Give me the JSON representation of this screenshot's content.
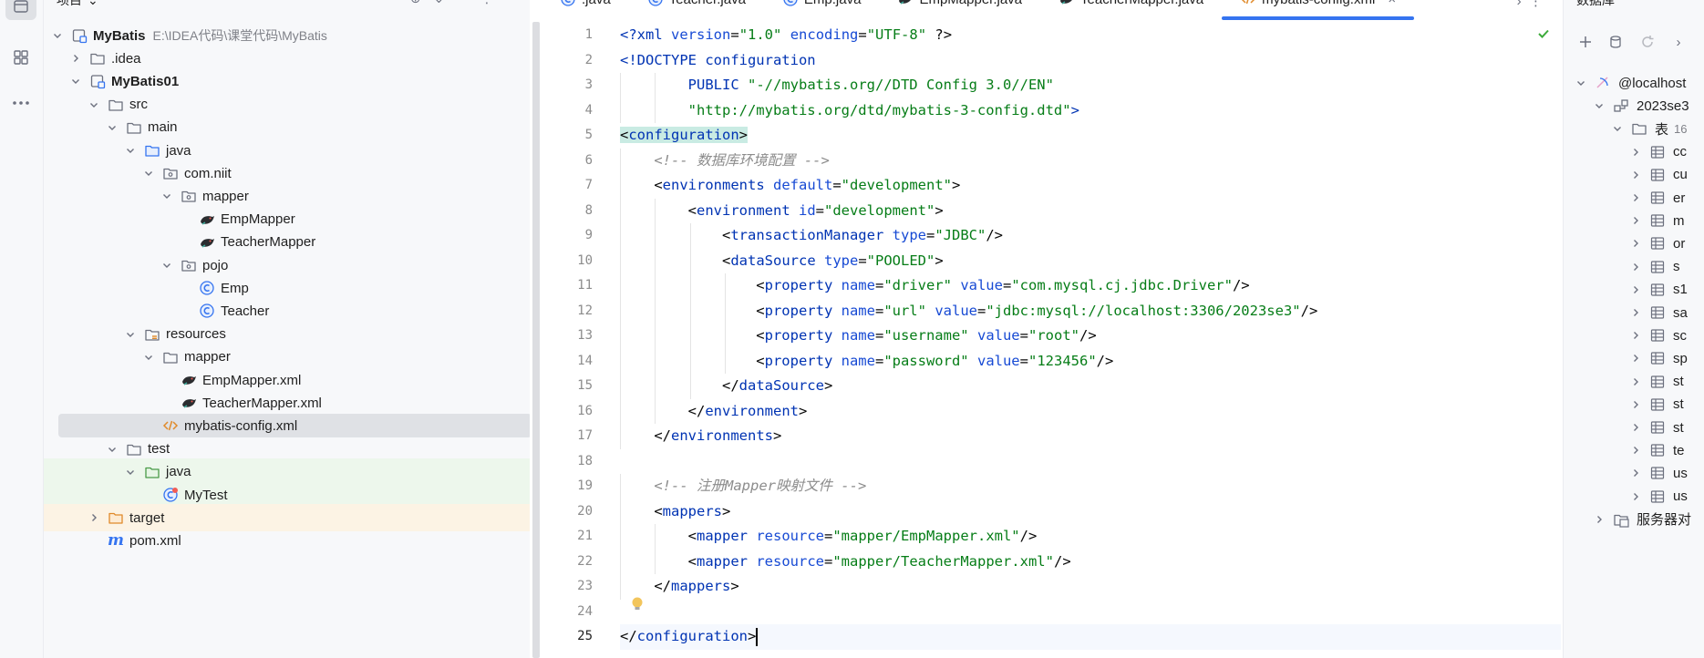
{
  "activity_bar": {
    "icons": [
      "project-icon",
      "structure-icon",
      "more-icon"
    ]
  },
  "project_panel": {
    "title": "项目",
    "tree": [
      {
        "label": "MyBatis",
        "path": "E:\\IDEA代码\\课堂代码\\MyBatis",
        "icon": "module-icon",
        "depth": 0,
        "expanded": true,
        "bold": true
      },
      {
        "label": ".idea",
        "icon": "folder-icon",
        "depth": 1,
        "expanded": false
      },
      {
        "label": "MyBatis01",
        "icon": "module-icon",
        "depth": 1,
        "expanded": true,
        "bold": true
      },
      {
        "label": "src",
        "icon": "folder-icon",
        "depth": 2,
        "expanded": true
      },
      {
        "label": "main",
        "icon": "folder-icon",
        "depth": 3,
        "expanded": true
      },
      {
        "label": "java",
        "icon": "source-folder-icon",
        "depth": 4,
        "expanded": true
      },
      {
        "label": "com.niit",
        "icon": "package-icon",
        "depth": 5,
        "expanded": true
      },
      {
        "label": "mapper",
        "icon": "package-icon",
        "depth": 6,
        "expanded": true
      },
      {
        "label": "EmpMapper",
        "icon": "mybatis-bird-icon",
        "depth": 7,
        "leaf": true
      },
      {
        "label": "TeacherMapper",
        "icon": "mybatis-bird-icon",
        "depth": 7,
        "leaf": true
      },
      {
        "label": "pojo",
        "icon": "package-icon",
        "depth": 6,
        "expanded": true
      },
      {
        "label": "Emp",
        "icon": "class-icon",
        "depth": 7,
        "leaf": true
      },
      {
        "label": "Teacher",
        "icon": "class-icon",
        "depth": 7,
        "leaf": true
      },
      {
        "label": "resources",
        "icon": "resources-folder-icon",
        "depth": 4,
        "expanded": true
      },
      {
        "label": "mapper",
        "icon": "folder-icon",
        "depth": 5,
        "expanded": true
      },
      {
        "label": "EmpMapper.xml",
        "icon": "mybatis-bird-icon",
        "depth": 6,
        "leaf": true
      },
      {
        "label": "TeacherMapper.xml",
        "icon": "mybatis-bird-icon",
        "depth": 6,
        "leaf": true
      },
      {
        "label": "mybatis-config.xml",
        "icon": "xml-icon",
        "depth": 5,
        "leaf": true,
        "selected": true
      },
      {
        "label": "test",
        "icon": "folder-icon",
        "depth": 3,
        "expanded": true
      },
      {
        "label": "java",
        "icon": "test-folder-icon",
        "depth": 4,
        "expanded": true,
        "highlight": "green"
      },
      {
        "label": "MyTest",
        "icon": "test-class-icon",
        "depth": 5,
        "leaf": true,
        "highlight": "green"
      },
      {
        "label": "target",
        "icon": "excluded-folder-icon",
        "depth": 2,
        "expanded": false,
        "highlight": "orange"
      },
      {
        "label": "pom.xml",
        "icon": "maven-icon",
        "depth": 2,
        "leaf": true
      }
    ]
  },
  "editor": {
    "tabs": [
      {
        "label": ".java",
        "icon": "class-icon"
      },
      {
        "label": "Teacher.java",
        "icon": "class-icon"
      },
      {
        "label": "Emp.java",
        "icon": "class-icon"
      },
      {
        "label": "EmpMapper.java",
        "icon": "mybatis-bird-icon"
      },
      {
        "label": "TeacherMapper.java",
        "icon": "mybatis-bird-icon"
      },
      {
        "label": "mybatis-config.xml",
        "icon": "xml-icon",
        "active": true
      }
    ],
    "current_line": 25,
    "lines": [
      [
        [
          "?",
          "<?"
        ],
        [
          "t",
          "xml"
        ],
        [
          "p",
          " "
        ],
        [
          "a",
          "version"
        ],
        [
          "p",
          "="
        ],
        [
          "v",
          "\"1.0\""
        ],
        [
          "p",
          " "
        ],
        [
          "a",
          "encoding"
        ],
        [
          "p",
          "="
        ],
        [
          "v",
          "\"UTF-8\""
        ],
        [
          "p",
          " ?>"
        ]
      ],
      [
        [
          "t",
          "<!DOCTYPE configuration"
        ]
      ],
      [
        [
          "p",
          "        "
        ],
        [
          "t",
          "PUBLIC"
        ],
        [
          "p",
          " "
        ],
        [
          "v",
          "\"-//mybatis.org//DTD Config 3.0//EN\""
        ]
      ],
      [
        [
          "p",
          "        "
        ],
        [
          "v",
          "\"http://mybatis.org/dtd/mybatis-3-config.dtd\""
        ],
        [
          "t",
          ">"
        ]
      ],
      [
        [
          "h",
          "<"
        ],
        [
          "ht",
          "configuration"
        ],
        [
          "h",
          ">"
        ]
      ],
      [
        [
          "p",
          "    "
        ],
        [
          "c",
          "<!-- 数据库环境配置 -->"
        ]
      ],
      [
        [
          "p",
          "    <"
        ],
        [
          "t",
          "environments"
        ],
        [
          "p",
          " "
        ],
        [
          "a",
          "default"
        ],
        [
          "p",
          "="
        ],
        [
          "v",
          "\"development\""
        ],
        [
          "p",
          ">"
        ]
      ],
      [
        [
          "p",
          "        <"
        ],
        [
          "t",
          "environment"
        ],
        [
          "p",
          " "
        ],
        [
          "a",
          "id"
        ],
        [
          "p",
          "="
        ],
        [
          "v",
          "\"development\""
        ],
        [
          "p",
          ">"
        ]
      ],
      [
        [
          "p",
          "            <"
        ],
        [
          "t",
          "transactionManager"
        ],
        [
          "p",
          " "
        ],
        [
          "a",
          "type"
        ],
        [
          "p",
          "="
        ],
        [
          "v",
          "\"JDBC\""
        ],
        [
          "p",
          "/>"
        ]
      ],
      [
        [
          "p",
          "            <"
        ],
        [
          "t",
          "dataSource"
        ],
        [
          "p",
          " "
        ],
        [
          "a",
          "type"
        ],
        [
          "p",
          "="
        ],
        [
          "v",
          "\"POOLED\""
        ],
        [
          "p",
          ">"
        ]
      ],
      [
        [
          "p",
          "                <"
        ],
        [
          "t",
          "property"
        ],
        [
          "p",
          " "
        ],
        [
          "a",
          "name"
        ],
        [
          "p",
          "="
        ],
        [
          "v",
          "\"driver\""
        ],
        [
          "p",
          " "
        ],
        [
          "a",
          "value"
        ],
        [
          "p",
          "="
        ],
        [
          "v",
          "\"com.mysql.cj.jdbc.Driver\""
        ],
        [
          "p",
          "/>"
        ]
      ],
      [
        [
          "p",
          "                <"
        ],
        [
          "t",
          "property"
        ],
        [
          "p",
          " "
        ],
        [
          "a",
          "name"
        ],
        [
          "p",
          "="
        ],
        [
          "v",
          "\"url\""
        ],
        [
          "p",
          " "
        ],
        [
          "a",
          "value"
        ],
        [
          "p",
          "="
        ],
        [
          "v",
          "\"jdbc:mysql://localhost:3306/2023se3\""
        ],
        [
          "p",
          "/>"
        ]
      ],
      [
        [
          "p",
          "                <"
        ],
        [
          "t",
          "property"
        ],
        [
          "p",
          " "
        ],
        [
          "a",
          "name"
        ],
        [
          "p",
          "="
        ],
        [
          "v",
          "\"username\""
        ],
        [
          "p",
          " "
        ],
        [
          "a",
          "value"
        ],
        [
          "p",
          "="
        ],
        [
          "v",
          "\"root\""
        ],
        [
          "p",
          "/>"
        ]
      ],
      [
        [
          "p",
          "                <"
        ],
        [
          "t",
          "property"
        ],
        [
          "p",
          " "
        ],
        [
          "a",
          "name"
        ],
        [
          "p",
          "="
        ],
        [
          "v",
          "\"password\""
        ],
        [
          "p",
          " "
        ],
        [
          "a",
          "value"
        ],
        [
          "p",
          "="
        ],
        [
          "v",
          "\"123456\""
        ],
        [
          "p",
          "/>"
        ]
      ],
      [
        [
          "p",
          "            </"
        ],
        [
          "t",
          "dataSource"
        ],
        [
          "p",
          ">"
        ]
      ],
      [
        [
          "p",
          "        </"
        ],
        [
          "t",
          "environment"
        ],
        [
          "p",
          ">"
        ]
      ],
      [
        [
          "p",
          "    </"
        ],
        [
          "t",
          "environments"
        ],
        [
          "p",
          ">"
        ]
      ],
      [],
      [
        [
          "p",
          "    "
        ],
        [
          "c",
          "<!-- 注册Mapper映射文件 -->"
        ]
      ],
      [
        [
          "p",
          "    <"
        ],
        [
          "t",
          "mappers"
        ],
        [
          "p",
          ">"
        ]
      ],
      [
        [
          "p",
          "        <"
        ],
        [
          "t",
          "mapper"
        ],
        [
          "p",
          " "
        ],
        [
          "a",
          "resource"
        ],
        [
          "p",
          "="
        ],
        [
          "v",
          "\"mapper/EmpMapper.xml\""
        ],
        [
          "p",
          "/>"
        ]
      ],
      [
        [
          "p",
          "        <"
        ],
        [
          "t",
          "mapper"
        ],
        [
          "p",
          " "
        ],
        [
          "a",
          "resource"
        ],
        [
          "p",
          "="
        ],
        [
          "v",
          "\"mapper/TeacherMapper.xml\""
        ],
        [
          "p",
          "/>"
        ]
      ],
      [
        [
          "p",
          "    </"
        ],
        [
          "t",
          "mappers"
        ],
        [
          "p",
          ">"
        ]
      ],
      [],
      [
        [
          "p",
          "</"
        ],
        [
          "t",
          "configuration"
        ],
        [
          "p",
          ">"
        ]
      ]
    ]
  },
  "database_panel": {
    "title": "数据库",
    "tree": [
      {
        "label": "@localhost",
        "icon": "datasource-icon",
        "depth": 0,
        "expanded": true
      },
      {
        "label": "2023se3",
        "icon": "schema-icon",
        "depth": 1,
        "expanded": true
      },
      {
        "label": "表",
        "count": "16",
        "icon": "folder-icon",
        "depth": 2,
        "expanded": true
      },
      {
        "label": "cc",
        "icon": "table-icon",
        "depth": 3
      },
      {
        "label": "cu",
        "icon": "table-icon",
        "depth": 3
      },
      {
        "label": "er",
        "icon": "table-icon",
        "depth": 3
      },
      {
        "label": "m",
        "icon": "table-icon",
        "depth": 3
      },
      {
        "label": "or",
        "icon": "table-icon",
        "depth": 3
      },
      {
        "label": "s",
        "icon": "table-icon",
        "depth": 3
      },
      {
        "label": "s1",
        "icon": "table-icon",
        "depth": 3
      },
      {
        "label": "sa",
        "icon": "table-icon",
        "depth": 3
      },
      {
        "label": "sc",
        "icon": "table-icon",
        "depth": 3
      },
      {
        "label": "sp",
        "icon": "table-icon",
        "depth": 3
      },
      {
        "label": "st",
        "icon": "table-icon",
        "depth": 3
      },
      {
        "label": "st",
        "icon": "table-icon",
        "depth": 3
      },
      {
        "label": "st",
        "icon": "table-icon",
        "depth": 3
      },
      {
        "label": "te",
        "icon": "table-icon",
        "depth": 3
      },
      {
        "label": "us",
        "icon": "table-icon",
        "depth": 3
      },
      {
        "label": "us",
        "icon": "table-icon",
        "depth": 3
      },
      {
        "label": "服务器对",
        "icon": "server-objects-icon",
        "depth": 1,
        "expanded": false
      }
    ]
  }
}
